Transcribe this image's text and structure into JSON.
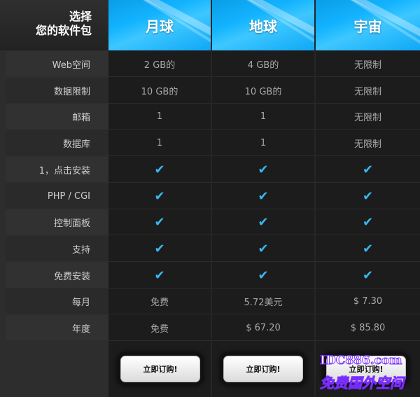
{
  "corner": {
    "line1": "选择",
    "line2": "您的软件包"
  },
  "plans": [
    {
      "name": "月球"
    },
    {
      "name": "地球"
    },
    {
      "name": "宇宙"
    }
  ],
  "rows": [
    {
      "label": "Web空间",
      "values": [
        "2 GB的",
        "4 GB的",
        "无限制"
      ]
    },
    {
      "label": "数据限制",
      "values": [
        "10 GB的",
        "10 GB的",
        "无限制"
      ]
    },
    {
      "label": "邮箱",
      "values": [
        "1",
        "1",
        "无限制"
      ]
    },
    {
      "label": "数据库",
      "values": [
        "1",
        "1",
        "无限制"
      ]
    },
    {
      "label": "1，点击安装",
      "values": [
        "✔",
        "✔",
        "✔"
      ]
    },
    {
      "label": "PHP / CGI",
      "values": [
        "✔",
        "✔",
        "✔"
      ]
    },
    {
      "label": "控制面板",
      "values": [
        "✔",
        "✔",
        "✔"
      ]
    },
    {
      "label": "支持",
      "values": [
        "✔",
        "✔",
        "✔"
      ]
    },
    {
      "label": "免费安装",
      "values": [
        "✔",
        "✔",
        "✔"
      ]
    },
    {
      "label": "每月",
      "values": [
        "免费",
        "5.72美元",
        "$ 7.30"
      ]
    },
    {
      "label": "年度",
      "values": [
        "免费",
        "$ 67.20",
        "$ 85.80"
      ]
    }
  ],
  "order_button_label": "立即订购!",
  "watermark": {
    "line1": "IDC886.com",
    "line2": "免费国外空间"
  },
  "colors": {
    "accent": "#13b3ff",
    "check": "#3ab7ee"
  }
}
